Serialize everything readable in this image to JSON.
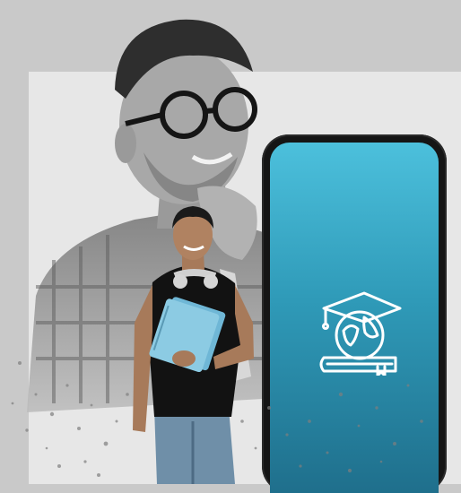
{
  "scene": {
    "background_color": "#c9c9c9",
    "panel_color": "#e7e7e7",
    "phone_gradient": [
      "#4cc0dc",
      "#2f9ab8",
      "#1f6f8c"
    ],
    "icon": "graduation-cap-globe-book-icon",
    "icon_color": "#ffffff"
  }
}
